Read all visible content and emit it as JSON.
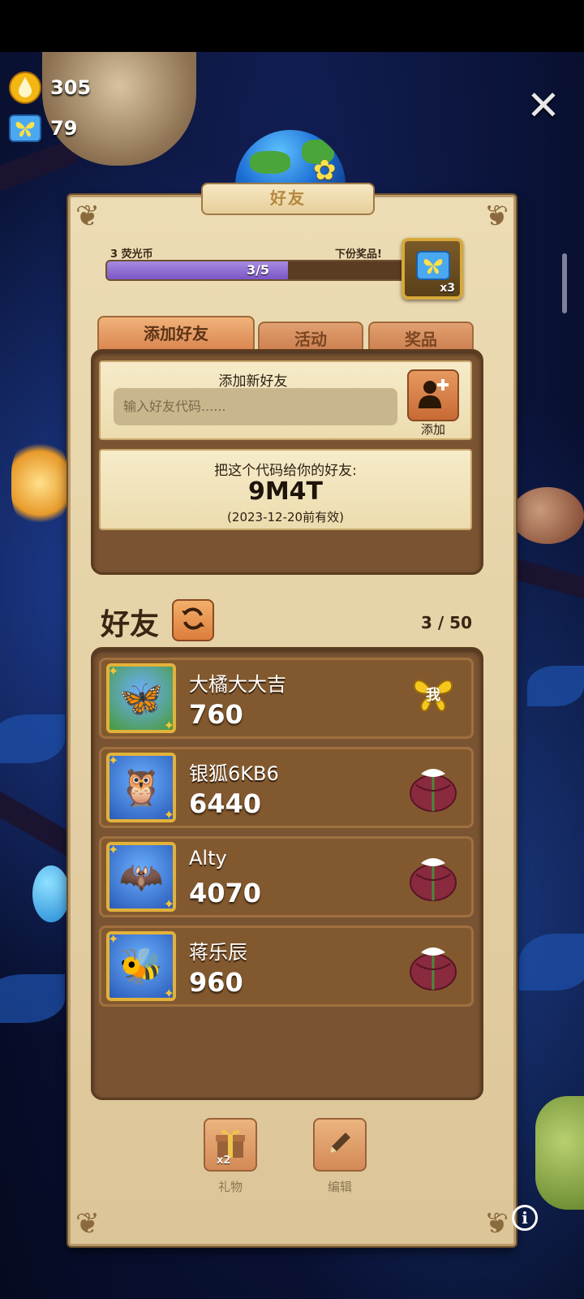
{
  "resources": {
    "drops": "305",
    "butterflies": "79"
  },
  "panel": {
    "title": "好友"
  },
  "progress": {
    "left_label": "3 荧光币",
    "right_label": "下份奖品!",
    "text": "3/5",
    "fraction": 0.6,
    "reward_multiplier": "x3"
  },
  "tabs": [
    {
      "label": "添加好友",
      "active": true
    },
    {
      "label": "活动",
      "active": false
    },
    {
      "label": "奖品",
      "active": false
    }
  ],
  "add_friend": {
    "heading": "添加新好友",
    "placeholder": "输入好友代码......",
    "button_label": "添加"
  },
  "share_code": {
    "heading": "把这个代码给你的好友:",
    "code": "9M4T",
    "validity": "(2023-12-20前有效)"
  },
  "friends": {
    "title": "好友",
    "count": "3 / 50",
    "list": [
      {
        "name": "大橘大大吉",
        "score": "760",
        "action": "me",
        "badge": "我",
        "avatar": "butterfly-avatar",
        "avatar_bg": "#4a9a3a"
      },
      {
        "name": "银狐6KB6",
        "score": "6440",
        "action": "gift",
        "avatar": "owl-avatar",
        "avatar_bg": "#2a5ab8"
      },
      {
        "name": "Alty",
        "score": "4070",
        "action": "gift",
        "avatar": "moth-avatar",
        "avatar_bg": "#2a5ab8"
      },
      {
        "name": "蒋乐辰",
        "score": "960",
        "action": "gift",
        "avatar": "bee-avatar",
        "avatar_bg": "#2a5ab8"
      }
    ]
  },
  "bottom": {
    "gift_label": "礼物",
    "gift_multiplier": "x2",
    "edit_label": "编辑"
  },
  "colors": {
    "accent": "#d9834e",
    "progress_fill": "#7a56c6",
    "frame_gold": "#e2b23a"
  }
}
